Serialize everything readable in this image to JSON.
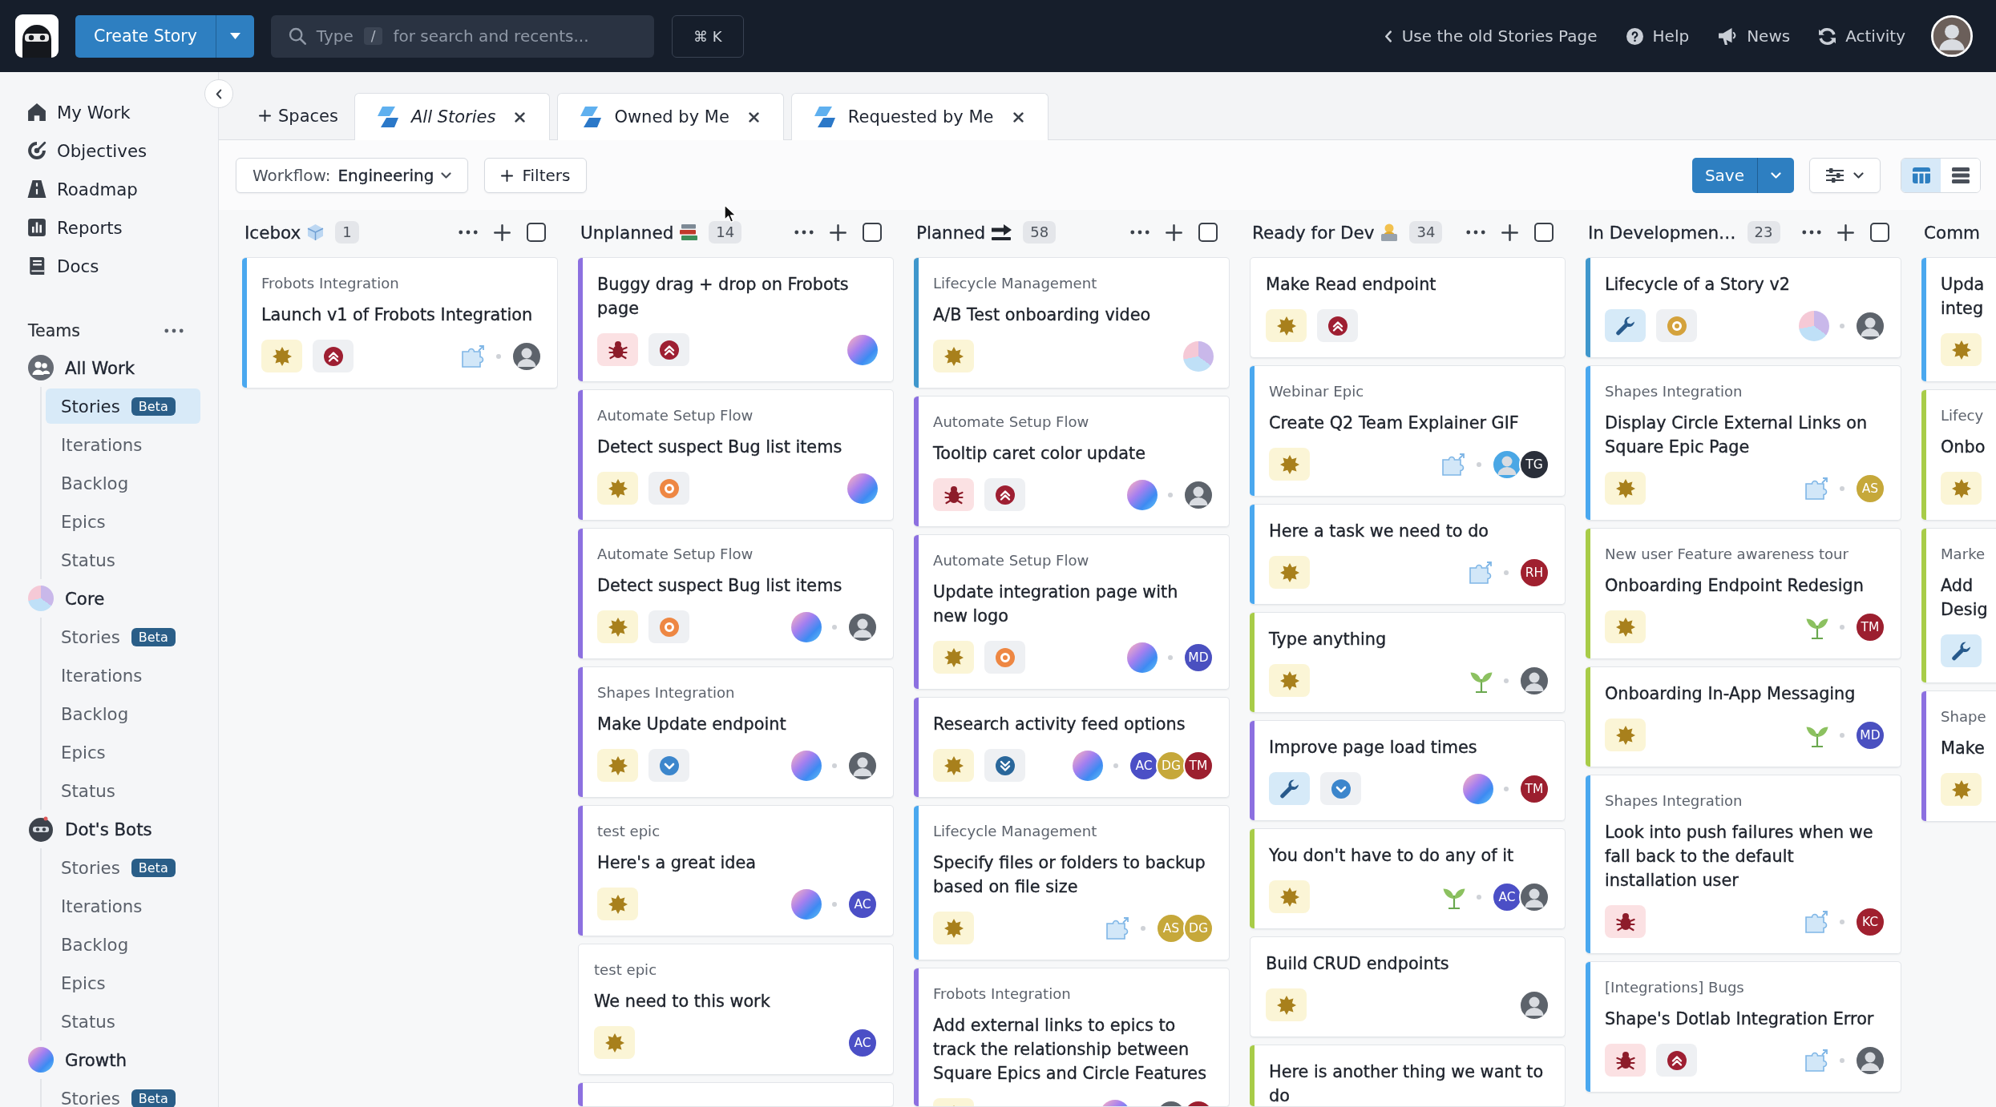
{
  "topbar": {
    "create": "Create Story",
    "search": {
      "hint": [
        {
          "kind": "text",
          "text": "Type"
        },
        {
          "kind": "key",
          "text": "/"
        },
        {
          "kind": "text",
          "text": "for search and recents..."
        }
      ]
    },
    "shortcut": "⌘ K",
    "links": [
      {
        "kind": "chevron-left",
        "label": "Use the old Stories Page"
      },
      {
        "kind": "help",
        "label": "Help"
      },
      {
        "kind": "megaphone",
        "label": "News"
      },
      {
        "kind": "cycle",
        "label": "Activity"
      }
    ]
  },
  "sidebar": {
    "nav": [
      {
        "kind": "home",
        "label": "My Work"
      },
      {
        "kind": "target",
        "label": "Objectives"
      },
      {
        "kind": "road",
        "label": "Roadmap"
      },
      {
        "kind": "bar-chart",
        "label": "Reports"
      },
      {
        "kind": "book",
        "label": "Docs"
      }
    ],
    "teams": {
      "title": "Teams",
      "items": [
        {
          "kind": "people",
          "name": "All Work",
          "children": [
            {
              "label": "Stories",
              "badge": "Beta",
              "selected": true
            },
            {
              "label": "Iterations",
              "selected": false
            },
            {
              "label": "Backlog",
              "selected": false
            },
            {
              "label": "Epics",
              "selected": false
            },
            {
              "label": "Status",
              "selected": false
            }
          ]
        },
        {
          "kind": "pastel",
          "name": "Core",
          "children": [
            {
              "label": "Stories",
              "badge": "Beta",
              "selected": false
            },
            {
              "label": "Iterations",
              "selected": false
            },
            {
              "label": "Backlog",
              "selected": false
            },
            {
              "label": "Epics",
              "selected": false
            },
            {
              "label": "Status",
              "selected": false
            }
          ]
        },
        {
          "kind": "bot",
          "name": "Dot's Bots",
          "children": [
            {
              "label": "Stories",
              "badge": "Beta",
              "selected": false
            },
            {
              "label": "Iterations",
              "selected": false
            },
            {
              "label": "Backlog",
              "selected": false
            },
            {
              "label": "Epics",
              "selected": false
            },
            {
              "label": "Status",
              "selected": false
            }
          ]
        },
        {
          "kind": "gradient",
          "name": "Growth",
          "children": [
            {
              "label": "Stories",
              "badge": "Beta",
              "selected": false
            }
          ]
        }
      ]
    }
  },
  "tabs": {
    "spaces": "Spaces",
    "items": [
      {
        "label": "All Stories",
        "unsaved": true
      },
      {
        "label": "Owned by Me",
        "unsaved": false
      },
      {
        "label": "Requested by Me",
        "unsaved": false
      }
    ]
  },
  "toolbar": {
    "workflow": {
      "label": "Workflow:",
      "value": "Engineering"
    },
    "filters": "Filters",
    "save": "Save",
    "views": [
      {
        "kind": "board",
        "selected": true
      },
      {
        "kind": "list",
        "selected": false
      }
    ]
  },
  "board": {
    "columns": [
      {
        "kind": "ice-cube",
        "name": "Icebox",
        "count": "1",
        "checked": false,
        "cards": [
          {
            "epic": "Frobots Integration",
            "title": "Launch v1 of Frobots Integration",
            "color": "#4aa8ef",
            "chips": [
              {
                "kind": "feature"
              },
              {
                "kind": "highest"
              }
            ],
            "marker": {
              "kind": "puzzle"
            },
            "owners": [
              {
                "kind": "photo"
              }
            ]
          }
        ]
      },
      {
        "kind": "books",
        "name": "Unplanned",
        "count": "14",
        "checked": false,
        "cards": [
          {
            "title": "Buggy drag + drop on Frobots page",
            "color": "#8c70e0",
            "chips": [
              {
                "kind": "bug"
              },
              {
                "kind": "highest"
              }
            ],
            "marker": {
              "kind": "gradient"
            }
          },
          {
            "epic": "Automate Setup Flow",
            "title": "Detect suspect Bug list items",
            "color": "#8c70e0",
            "chips": [
              {
                "kind": "feature"
              },
              {
                "kind": "high"
              }
            ],
            "marker": {
              "kind": "gradient"
            }
          },
          {
            "epic": "Automate Setup Flow",
            "title": "Detect suspect Bug list items",
            "color": "#8c70e0",
            "chips": [
              {
                "kind": "feature"
              },
              {
                "kind": "high"
              }
            ],
            "marker": {
              "kind": "gradient"
            },
            "owners": [
              {
                "kind": "photo"
              }
            ]
          },
          {
            "epic": "Shapes Integration",
            "title": "Make Update endpoint",
            "color": "#8c70e0",
            "chips": [
              {
                "kind": "feature"
              },
              {
                "kind": "low"
              }
            ],
            "marker": {
              "kind": "gradient"
            },
            "owners": [
              {
                "kind": "photo"
              }
            ]
          },
          {
            "epic": "test epic",
            "title": "Here's a great idea",
            "color": "#8c70e0",
            "chips": [
              {
                "kind": "feature"
              }
            ],
            "marker": {
              "kind": "gradient"
            },
            "owners": [
              {
                "kind": "initials",
                "initials": "AC",
                "color": "#4b4fc6"
              }
            ]
          },
          {
            "epic": "test epic",
            "title": "We need to this work",
            "chips": [
              {
                "kind": "feature"
              }
            ],
            "owners": [
              {
                "kind": "initials",
                "initials": "AC",
                "color": "#4b4fc6"
              }
            ]
          },
          {
            "color": "#8c70e0"
          }
        ]
      },
      {
        "kind": "soon-arrow",
        "name": "Planned",
        "count": "58",
        "checked": false,
        "cards": [
          {
            "epic": "Lifecycle Management",
            "title": "A/B Test onboarding video",
            "color": "#3f97cc",
            "chips": [
              {
                "kind": "feature"
              }
            ],
            "marker": {
              "kind": "pastel"
            }
          },
          {
            "epic": "Automate Setup Flow",
            "title": "Tooltip caret color update",
            "color": "#8c70e0",
            "chips": [
              {
                "kind": "bug"
              },
              {
                "kind": "highest"
              }
            ],
            "marker": {
              "kind": "gradient"
            },
            "owners": [
              {
                "kind": "photo"
              }
            ]
          },
          {
            "epic": "Automate Setup Flow",
            "title": "Update integration page with new logo",
            "color": "#8c70e0",
            "chips": [
              {
                "kind": "feature"
              },
              {
                "kind": "high"
              }
            ],
            "marker": {
              "kind": "gradient"
            },
            "owners": [
              {
                "kind": "initials",
                "initials": "MD",
                "color": "#4a50c0"
              }
            ]
          },
          {
            "title": "Research activity feed options",
            "color": "#8c70e0",
            "chips": [
              {
                "kind": "feature"
              },
              {
                "kind": "lowest"
              }
            ],
            "marker": {
              "kind": "gradient"
            },
            "owners": [
              {
                "kind": "initials",
                "initials": "AC",
                "color": "#4b4fc6"
              },
              {
                "kind": "initials",
                "initials": "DG",
                "color": "#c6a83a"
              },
              {
                "kind": "initials",
                "initials": "TM",
                "color": "#9c1f2f"
              }
            ]
          },
          {
            "epic": "Lifecycle Management",
            "title": "Specify files or folders to backup based on file size",
            "color": "#4aa8ef",
            "chips": [
              {
                "kind": "feature"
              }
            ],
            "marker": {
              "kind": "puzzle"
            },
            "owners": [
              {
                "kind": "initials",
                "initials": "AS",
                "color": "#c6a83a"
              },
              {
                "kind": "initials",
                "initials": "DG",
                "color": "#c6a83a"
              }
            ]
          },
          {
            "epic": "Frobots Integration",
            "title": "Add external links to epics to track the relationship between Square Epics and Circle Features",
            "color": "#8c70e0",
            "chips": [
              {
                "kind": "feature"
              }
            ],
            "marker": {
              "kind": "gradient"
            },
            "owners": [
              {
                "kind": "photo"
              },
              {
                "kind": "initials",
                "color": "#9c1f2f"
              }
            ]
          }
        ]
      },
      {
        "kind": "person-at-laptop",
        "name": "Ready for Dev",
        "count": "34",
        "checked": false,
        "cards": [
          {
            "title": "Make Read endpoint",
            "chips": [
              {
                "kind": "feature"
              },
              {
                "kind": "highest"
              }
            ]
          },
          {
            "epic": "Webinar Epic",
            "title": "Create Q2 Team Explainer GIF",
            "color": "#4aa8ef",
            "chips": [
              {
                "kind": "feature"
              }
            ],
            "marker": {
              "kind": "puzzle"
            },
            "owners": [
              {
                "kind": "photo",
                "color": "#4aa7e5"
              },
              {
                "kind": "initials",
                "initials": "TG",
                "color": "#2a2f3a"
              }
            ]
          },
          {
            "title": "Here a task we need to do",
            "color": "#4aa8ef",
            "chips": [
              {
                "kind": "feature"
              }
            ],
            "marker": {
              "kind": "puzzle"
            },
            "owners": [
              {
                "kind": "initials",
                "initials": "RH",
                "color": "#a0202f"
              }
            ]
          },
          {
            "title": "Type anything",
            "color": "#a8cc48",
            "chips": [
              {
                "kind": "feature"
              }
            ],
            "marker": {
              "kind": "sprout"
            },
            "owners": [
              {
                "kind": "photo"
              }
            ]
          },
          {
            "title": "Improve page load times",
            "color": "#8c70e0",
            "chips": [
              {
                "kind": "chore"
              },
              {
                "kind": "low"
              }
            ],
            "marker": {
              "kind": "gradient"
            },
            "owners": [
              {
                "kind": "initials",
                "initials": "TM",
                "color": "#9c1f2f"
              }
            ]
          },
          {
            "title": "You don't have to do any of it",
            "color": "#a8cc48",
            "chips": [
              {
                "kind": "feature"
              }
            ],
            "marker": {
              "kind": "sprout"
            },
            "owners": [
              {
                "kind": "initials",
                "initials": "AC",
                "color": "#4b4fc6"
              },
              {
                "kind": "photo"
              }
            ]
          },
          {
            "title": "Build CRUD endpoints",
            "chips": [
              {
                "kind": "feature"
              }
            ],
            "owners": [
              {
                "kind": "photo"
              }
            ]
          },
          {
            "title": "Here is another thing we want to do",
            "color": "#a8cc48"
          }
        ]
      },
      {
        "name": "In Developmen…",
        "count": "23",
        "checked": false,
        "cards": [
          {
            "title": "Lifecycle of a Story v2",
            "color": "#3f97cc",
            "chips": [
              {
                "kind": "chore"
              },
              {
                "kind": "medium"
              }
            ],
            "marker": {
              "kind": "pastel"
            },
            "owners": [
              {
                "kind": "photo"
              }
            ]
          },
          {
            "epic": "Shapes Integration",
            "title": "Display Circle External Links on Square Epic Page",
            "color": "#4aa8ef",
            "chips": [
              {
                "kind": "feature"
              }
            ],
            "marker": {
              "kind": "puzzle"
            },
            "owners": [
              {
                "kind": "initials",
                "initials": "AS",
                "color": "#c6a83a"
              }
            ]
          },
          {
            "epic": "New user Feature awareness tour",
            "title": "Onboarding Endpoint Redesign",
            "color": "#a8cc48",
            "chips": [
              {
                "kind": "feature"
              }
            ],
            "marker": {
              "kind": "sprout"
            },
            "owners": [
              {
                "kind": "initials",
                "initials": "TM",
                "color": "#9c1f2f"
              }
            ]
          },
          {
            "title": "Onboarding In-App Messaging",
            "color": "#a8cc48",
            "chips": [
              {
                "kind": "feature"
              }
            ],
            "marker": {
              "kind": "sprout"
            },
            "owners": [
              {
                "kind": "initials",
                "initials": "MD",
                "color": "#4a50c0"
              }
            ]
          },
          {
            "epic": "Shapes Integration",
            "title": "Look into push failures when we fall back to the default installation user",
            "color": "#4aa8ef",
            "chips": [
              {
                "kind": "bug"
              }
            ],
            "marker": {
              "kind": "puzzle"
            },
            "owners": [
              {
                "kind": "initials",
                "initials": "KC",
                "color": "#a0202f"
              }
            ]
          },
          {
            "epic": "[Integrations] Bugs",
            "title": "Shape's Dotlab Integration Error",
            "color": "#4aa8ef",
            "chips": [
              {
                "kind": "bug"
              },
              {
                "kind": "highest"
              }
            ],
            "marker": {
              "kind": "puzzle"
            },
            "owners": [
              {
                "kind": "photo"
              }
            ]
          }
        ]
      },
      {
        "name": "Comm",
        "cards": [
          {
            "title": "Upda integ",
            "color": "#4aa8ef",
            "chips": [
              {
                "kind": "feature"
              }
            ]
          },
          {
            "epic": "Lifecy",
            "title": "Onbo",
            "color": "#a8cc48",
            "chips": [
              {
                "kind": "feature"
              }
            ]
          },
          {
            "epic": "Marke",
            "title": "Add Desig",
            "color": "#a8cc48",
            "chips": [
              {
                "kind": "chore"
              }
            ]
          },
          {
            "epic": "Shape",
            "title": "Make",
            "color": "#8c70e0",
            "chips": [
              {
                "kind": "feature"
              }
            ]
          }
        ]
      }
    ]
  }
}
